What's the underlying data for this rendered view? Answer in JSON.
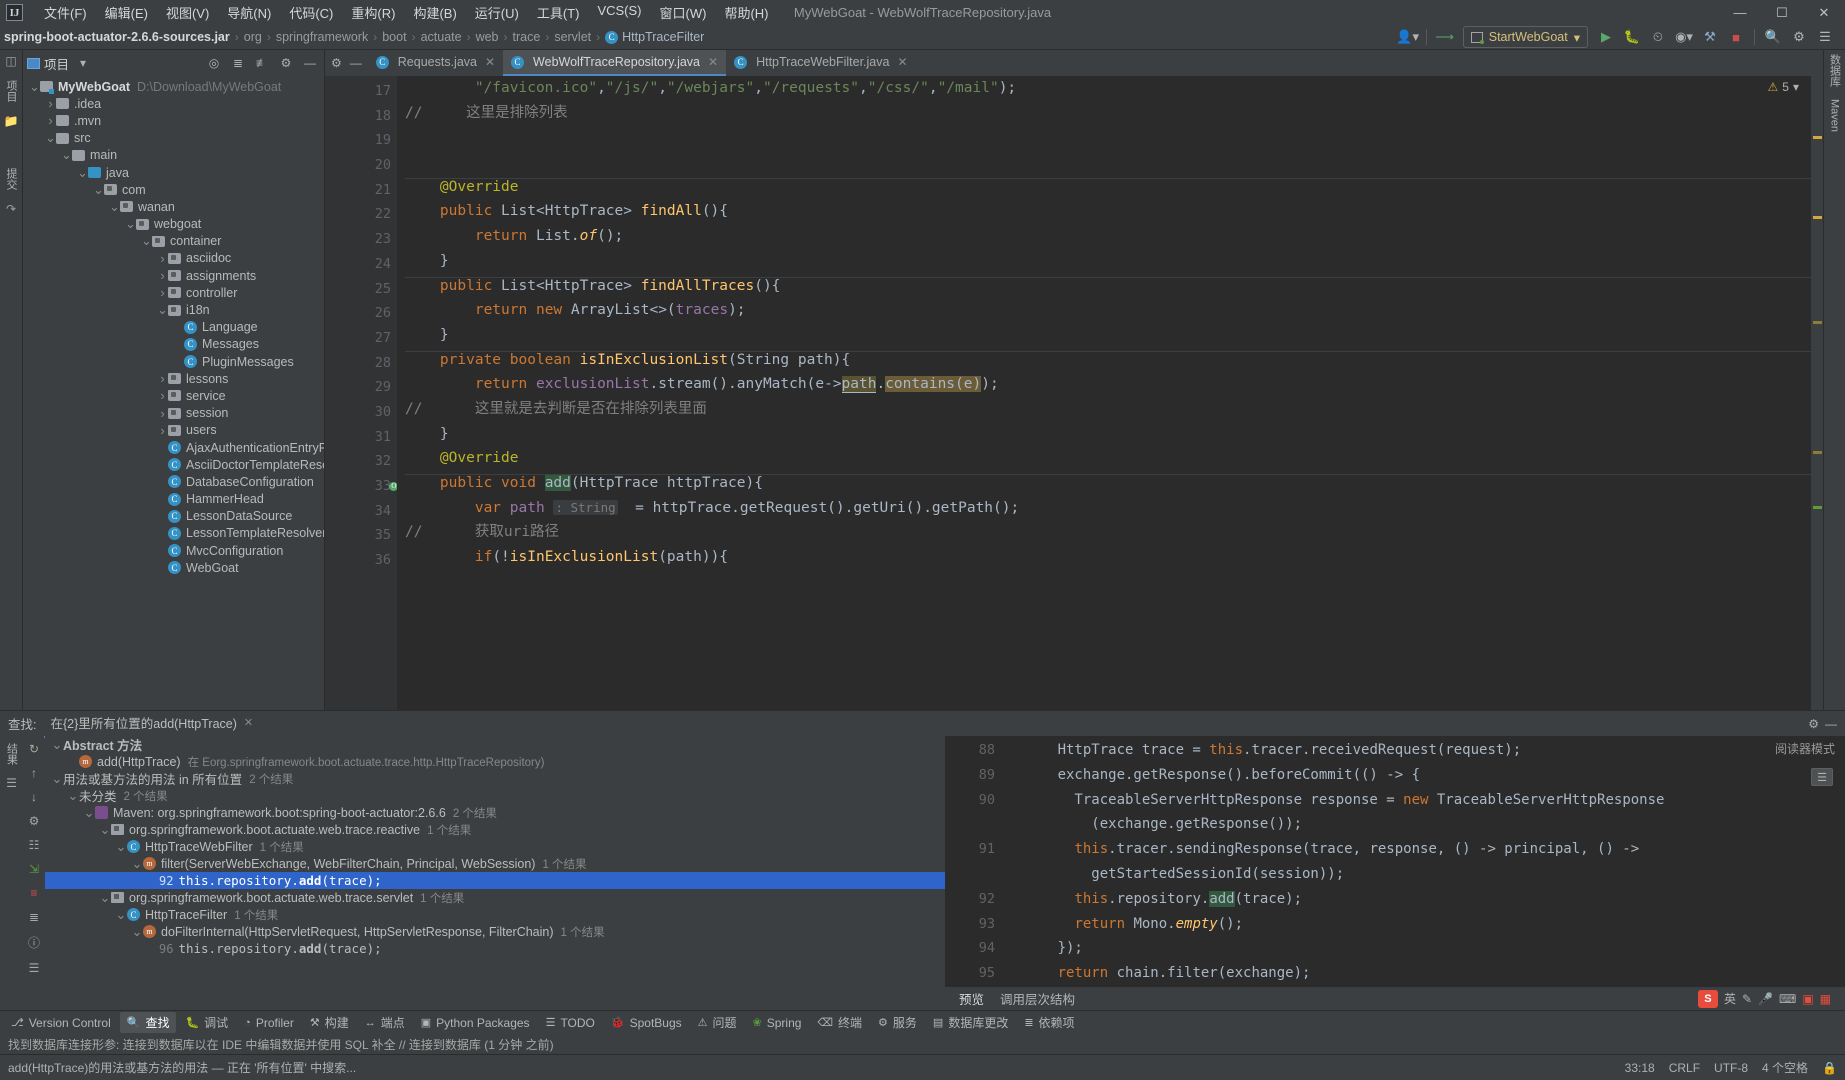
{
  "window": {
    "title": "MyWebGoat - WebWolfTraceRepository.java",
    "logo": "IJ",
    "controls": [
      "minimize-icon",
      "maximize-icon",
      "close-icon"
    ]
  },
  "menubar": [
    "文件(F)",
    "编辑(E)",
    "视图(V)",
    "导航(N)",
    "代码(C)",
    "重构(R)",
    "构建(B)",
    "运行(U)",
    "工具(T)",
    "VCS(S)",
    "窗口(W)",
    "帮助(H)"
  ],
  "navbar": {
    "crumbs": [
      "spring-boot-actuator-2.6.6-sources.jar",
      "org",
      "springframework",
      "boot",
      "actuate",
      "web",
      "trace",
      "servlet"
    ],
    "class_crumb": "HttpTraceFilter",
    "run_config": "StartWebGoat",
    "buttons": [
      "user-icon",
      "updates-icon",
      "run-icon",
      "debug-icon",
      "profile-icon",
      "coverage-icon",
      "build-icon",
      "stop-icon",
      "search-everywhere-icon",
      "settings-icon",
      "notifications-icon"
    ]
  },
  "project_panel": {
    "title": "项目",
    "header_icons": [
      "locate-icon",
      "expand-all-icon",
      "collapse-all-icon",
      "settings-icon",
      "hide-icon"
    ],
    "tree": [
      {
        "indent": 0,
        "arrow": "v",
        "icon": "module",
        "label": "MyWebGoat",
        "bold": true,
        "path": "D:\\Download\\MyWebGoat"
      },
      {
        "indent": 1,
        "arrow": ">",
        "icon": "folder",
        "label": ".idea",
        "bold": false,
        "path": ""
      },
      {
        "indent": 1,
        "arrow": ">",
        "icon": "folder",
        "label": ".mvn",
        "bold": false,
        "path": ""
      },
      {
        "indent": 1,
        "arrow": "v",
        "icon": "folder",
        "label": "src",
        "bold": false,
        "path": ""
      },
      {
        "indent": 2,
        "arrow": "v",
        "icon": "folder",
        "label": "main",
        "bold": false,
        "path": ""
      },
      {
        "indent": 3,
        "arrow": "v",
        "icon": "folder-blue",
        "label": "java",
        "bold": false,
        "path": ""
      },
      {
        "indent": 4,
        "arrow": "v",
        "icon": "package",
        "label": "com",
        "bold": false,
        "path": ""
      },
      {
        "indent": 5,
        "arrow": "v",
        "icon": "package",
        "label": "wanan",
        "bold": false,
        "path": ""
      },
      {
        "indent": 6,
        "arrow": "v",
        "icon": "package",
        "label": "webgoat",
        "bold": false,
        "path": ""
      },
      {
        "indent": 7,
        "arrow": "v",
        "icon": "package",
        "label": "container",
        "bold": false,
        "path": ""
      },
      {
        "indent": 8,
        "arrow": ">",
        "icon": "package",
        "label": "asciidoc",
        "bold": false,
        "path": ""
      },
      {
        "indent": 8,
        "arrow": ">",
        "icon": "package",
        "label": "assignments",
        "bold": false,
        "path": ""
      },
      {
        "indent": 8,
        "arrow": ">",
        "icon": "package",
        "label": "controller",
        "bold": false,
        "path": ""
      },
      {
        "indent": 8,
        "arrow": "v",
        "icon": "package",
        "label": "i18n",
        "bold": false,
        "path": ""
      },
      {
        "indent": 9,
        "arrow": "",
        "icon": "class",
        "label": "Language",
        "bold": false,
        "path": ""
      },
      {
        "indent": 9,
        "arrow": "",
        "icon": "class",
        "label": "Messages",
        "bold": false,
        "path": ""
      },
      {
        "indent": 9,
        "arrow": "",
        "icon": "class",
        "label": "PluginMessages",
        "bold": false,
        "path": ""
      },
      {
        "indent": 8,
        "arrow": ">",
        "icon": "package",
        "label": "lessons",
        "bold": false,
        "path": ""
      },
      {
        "indent": 8,
        "arrow": ">",
        "icon": "package",
        "label": "service",
        "bold": false,
        "path": ""
      },
      {
        "indent": 8,
        "arrow": ">",
        "icon": "package",
        "label": "session",
        "bold": false,
        "path": ""
      },
      {
        "indent": 8,
        "arrow": ">",
        "icon": "package",
        "label": "users",
        "bold": false,
        "path": ""
      },
      {
        "indent": 8,
        "arrow": "",
        "icon": "class",
        "label": "AjaxAuthenticationEntryPoin",
        "bold": false,
        "path": ""
      },
      {
        "indent": 8,
        "arrow": "",
        "icon": "class",
        "label": "AsciiDoctorTemplateResolv",
        "bold": false,
        "path": ""
      },
      {
        "indent": 8,
        "arrow": "",
        "icon": "class",
        "label": "DatabaseConfiguration",
        "bold": false,
        "path": ""
      },
      {
        "indent": 8,
        "arrow": "",
        "icon": "class",
        "label": "HammerHead",
        "bold": false,
        "path": ""
      },
      {
        "indent": 8,
        "arrow": "",
        "icon": "class",
        "label": "LessonDataSource",
        "bold": false,
        "path": ""
      },
      {
        "indent": 8,
        "arrow": "",
        "icon": "class",
        "label": "LessonTemplateResolver",
        "bold": false,
        "path": ""
      },
      {
        "indent": 8,
        "arrow": "",
        "icon": "class",
        "label": "MvcConfiguration",
        "bold": false,
        "path": ""
      },
      {
        "indent": 8,
        "arrow": "",
        "icon": "class-run",
        "label": "WebGoat",
        "bold": false,
        "path": ""
      }
    ]
  },
  "left_rail": {
    "items": [
      "项目",
      "folder-icon",
      "提交",
      "拉取请求"
    ]
  },
  "right_rail": {
    "items": [
      "数据库",
      "Maven"
    ]
  },
  "editor": {
    "tabs": [
      {
        "label": "Requests.java",
        "active": false
      },
      {
        "label": "WebWolfTraceRepository.java",
        "active": true
      },
      {
        "label": "HttpTraceWebFilter.java",
        "active": false
      }
    ],
    "inspection": {
      "count": "5",
      "icon": "warning-icon"
    },
    "lines": [
      {
        "n": "17",
        "marks": [],
        "html": "        <span class=\"str\">\"/favicon.ico\"</span>,<span class=\"str\">\"/js/\"</span>,<span class=\"str\">\"/webjars\"</span>,<span class=\"str\">\"/requests\"</span>,<span class=\"str\">\"/css/\"</span>,<span class=\"str\">\"/mail\"</span>);"
      },
      {
        "n": "18",
        "marks": [],
        "html": "<span class=\"cmt\">//</span>     <span class=\"cmt\">这里是排除列表</span>"
      },
      {
        "n": "19",
        "marks": [],
        "html": ""
      },
      {
        "n": "20",
        "marks": [],
        "html": ""
      },
      {
        "n": "21",
        "marks": [],
        "html": "    <span class=\"ann\">@Override</span>"
      },
      {
        "n": "22",
        "marks": [
          "override",
          "up"
        ],
        "html": "    <span class=\"kw\">public</span> List&lt;HttpTrace&gt; <span class=\"fn\">findAll</span>(){"
      },
      {
        "n": "23",
        "marks": [],
        "html": "        <span class=\"kw\">return</span> List.<span class=\"fn\" style=\"font-style:italic\">of</span>();"
      },
      {
        "n": "24",
        "marks": [],
        "html": "    }"
      },
      {
        "n": "25",
        "marks": [],
        "html": "    <span class=\"kw\">public</span> List&lt;HttpTrace&gt; <span class=\"fn\">findAllTraces</span>(){"
      },
      {
        "n": "26",
        "marks": [],
        "html": "        <span class=\"kw\">return</span> <span class=\"kw\">new</span> ArrayList&lt;&gt;(<span class=\"fld\">traces</span>);"
      },
      {
        "n": "27",
        "marks": [],
        "html": "    }"
      },
      {
        "n": "28",
        "marks": [],
        "html": "    <span class=\"kw\">private</span> <span class=\"kw\">boolean</span> <span class=\"fn\">isInExclusionList</span>(String path){"
      },
      {
        "n": "29",
        "marks": [],
        "html": "        <span class=\"kw\">return</span> <span class=\"fld\">exclusionList</span>.stream().anyMatch(e-&gt;<span class=\"usg-hl2\">path</span>.<span class=\"usg-hl\">contains(e)</span>);"
      },
      {
        "n": "30",
        "marks": [],
        "html": "<span class=\"cmt\">//</span>      <span class=\"cmt\">这里就是去判断是否在排除列表里面</span>"
      },
      {
        "n": "31",
        "marks": [],
        "html": "    }"
      },
      {
        "n": "32",
        "marks": [],
        "html": "    <span class=\"ann\">@Override</span>"
      },
      {
        "n": "33",
        "marks": [
          "override",
          "up",
          "at"
        ],
        "html": "    <span class=\"kw\">public</span> <span class=\"kw\">void</span> <span class=\"sel-hl\">add</span>(HttpTrace httpTrace){"
      },
      {
        "n": "34",
        "marks": [],
        "html": "        <span class=\"kw\">var</span> <span class=\"fld\">path</span> <span class=\"hint\">: String</span>  = httpTrace.getRequest().getUri().getPath();"
      },
      {
        "n": "35",
        "marks": [],
        "html": "<span class=\"cmt\">//</span>      <span class=\"cmt\">获取uri路径</span>"
      },
      {
        "n": "36",
        "marks": [],
        "html": "        <span class=\"kw\">if</span>(!<span class=\"fn\">isInExclusionList</span>(path)){"
      }
    ]
  },
  "find_panel": {
    "label": "查找:",
    "tab": "在{2}里所有位置的add(HttpTrace)",
    "header_icons": [
      "settings-icon",
      "hide-icon"
    ],
    "rail_label": "结果",
    "side_icons": [
      "rerun-icon",
      "prev-occurrence-icon",
      "next-occurrence-icon",
      "settings-icon",
      "group-icon",
      "export-icon",
      "expand-icon",
      "collapse-icon",
      "help-icon",
      "filter-icon"
    ],
    "tree": [
      {
        "indent": 0,
        "arrow": "v",
        "icon": "none",
        "label": "Abstract 方法",
        "count": "",
        "selected": false,
        "bold_part": ""
      },
      {
        "indent": 1,
        "arrow": "",
        "icon": "method",
        "label": "add(HttpTrace)",
        "count": "",
        "selected": false,
        "suffix": "在 Eorg.springframework.boot.actuate.trace.http.HttpTraceRepository)"
      },
      {
        "indent": 0,
        "arrow": "v",
        "icon": "none",
        "label": "用法或基方法的用法 in 所有位置",
        "count": "2 个结果",
        "selected": false
      },
      {
        "indent": 1,
        "arrow": "v",
        "icon": "none",
        "label": "未分类",
        "count": "2 个结果",
        "selected": false
      },
      {
        "indent": 2,
        "arrow": "v",
        "icon": "maven",
        "label": "Maven: org.springframework.boot:spring-boot-actuator:2.6.6",
        "count": "2 个结果",
        "selected": false
      },
      {
        "indent": 3,
        "arrow": "v",
        "icon": "lib",
        "label": "org.springframework.boot.actuate.web.trace.reactive",
        "count": "1 个结果",
        "selected": false
      },
      {
        "indent": 4,
        "arrow": "v",
        "icon": "class",
        "label": "HttpTraceWebFilter",
        "count": "1 个结果",
        "selected": false
      },
      {
        "indent": 5,
        "arrow": "v",
        "icon": "method",
        "label": "filter(ServerWebExchange, WebFilterChain, Principal, WebSession)",
        "count": "1 个结果",
        "selected": false
      },
      {
        "indent": 6,
        "arrow": "",
        "icon": "none",
        "linenum": "92",
        "code_pre": "this.repository.",
        "code_hit": "add",
        "code_post": "(trace);",
        "selected": true
      },
      {
        "indent": 3,
        "arrow": "v",
        "icon": "lib",
        "label": "org.springframework.boot.actuate.web.trace.servlet",
        "count": "1 个结果",
        "selected": false
      },
      {
        "indent": 4,
        "arrow": "v",
        "icon": "class",
        "label": "HttpTraceFilter",
        "count": "1 个结果",
        "selected": false
      },
      {
        "indent": 5,
        "arrow": "v",
        "icon": "method",
        "label": "doFilterInternal(HttpServletRequest, HttpServletResponse, FilterChain)",
        "count": "1 个结果",
        "selected": false
      },
      {
        "indent": 6,
        "arrow": "",
        "icon": "none",
        "linenum": "96",
        "code_pre": "this.repository.",
        "code_hit": "add",
        "code_post": "(trace);",
        "selected": false
      }
    ]
  },
  "preview": {
    "badge": "阅读器模式",
    "lines": [
      {
        "n": "88",
        "html": "      HttpTrace trace = <span class=\"kw\">this</span>.tracer.receivedRequest(request);"
      },
      {
        "n": "89",
        "html": "      exchange.getResponse().beforeCommit(() -&gt; {"
      },
      {
        "n": "90",
        "html": "        TraceableServerHttpResponse response = <span class=\"kw\">new</span> TraceableServerHttpResponse"
      },
      {
        "n": "",
        "html": "          (exchange.getResponse());"
      },
      {
        "n": "91",
        "html": "        <span class=\"kw\">this</span>.tracer.sendingResponse(trace, response, () -&gt; principal, () -&gt;"
      },
      {
        "n": "",
        "html": "          getStartedSessionId(session));"
      },
      {
        "n": "92",
        "html": "        <span class=\"kw\">this</span>.repository.<span class=\"sel-hl\">add</span>(trace);"
      },
      {
        "n": "93",
        "html": "        <span class=\"kw\">return</span> Mono.<span class=\"fn\" style=\"font-style:italic\">empty</span>();"
      },
      {
        "n": "94",
        "html": "      });"
      },
      {
        "n": "95",
        "html": "      <span class=\"kw\">return</span> chain.filter(exchange);"
      },
      {
        "n": "96",
        "html": "    }"
      }
    ],
    "tabs": [
      {
        "label": "预览",
        "active": true
      },
      {
        "label": "调用层次结构",
        "active": false
      }
    ],
    "ime": {
      "logo": "S",
      "lang": "英",
      "icons": [
        "pencil-icon",
        "mic-icon",
        "keyboard-icon",
        "translate-icon",
        "apps-icon"
      ]
    }
  },
  "tool_strip": [
    {
      "label": "Version Control",
      "icon": "branch-icon",
      "active": false
    },
    {
      "label": "查找",
      "icon": "search-icon",
      "active": true
    },
    {
      "label": "调试",
      "icon": "bug-icon",
      "active": false
    },
    {
      "label": "Profiler",
      "icon": "gauge-icon",
      "active": false
    },
    {
      "label": "构建",
      "icon": "hammer-icon",
      "active": false
    },
    {
      "label": "端点",
      "icon": "endpoint-icon",
      "active": false
    },
    {
      "label": "Python Packages",
      "icon": "python-icon",
      "active": false
    },
    {
      "label": "TODO",
      "icon": "todo-icon",
      "active": false
    },
    {
      "label": "SpotBugs",
      "icon": "bug2-icon",
      "active": false
    },
    {
      "label": "问题",
      "icon": "problems-icon",
      "active": false
    },
    {
      "label": "Spring",
      "icon": "spring-icon",
      "active": false
    },
    {
      "label": "终端",
      "icon": "terminal-icon",
      "active": false
    },
    {
      "label": "服务",
      "icon": "services-icon",
      "active": false
    },
    {
      "label": "数据库更改",
      "icon": "db-icon",
      "active": false
    },
    {
      "label": "依赖项",
      "icon": "deps-icon",
      "active": false
    }
  ],
  "message_row": {
    "text": "找到数据库连接形参: 连接到数据库以在 IDE 中编辑数据并使用 SQL 补全 // 连接到数据库 (1 分钟 之前)"
  },
  "status_bar": {
    "message": "add(HttpTrace)的用法或基方法的用法 — 正在 '所有位置' 中搜索...",
    "position": "33:18",
    "line_sep": "CRLF",
    "encoding": "UTF-8",
    "indent": "4 个空格",
    "lock": "lock-icon"
  }
}
